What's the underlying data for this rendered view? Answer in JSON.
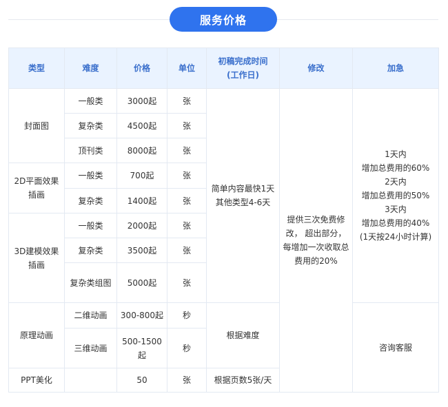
{
  "title": "服务价格",
  "headers": {
    "type": "类型",
    "difficulty": "难度",
    "price": "价格",
    "unit": "单位",
    "first_draft_line1": "初稿完成时间",
    "first_draft_line2": "(工作日)",
    "revision": "修改",
    "rush": "加急"
  },
  "categories": {
    "cover": "封面图",
    "flat2d": "2D平面效果插画",
    "model3d": "3D建模效果插画",
    "animation": "原理动画",
    "ppt": "PPT美化"
  },
  "rows": [
    {
      "difficulty": "一般类",
      "price": "3000起",
      "unit": "张"
    },
    {
      "difficulty": "复杂类",
      "price": "4500起",
      "unit": "张"
    },
    {
      "difficulty": "顶刊类",
      "price": "8000起",
      "unit": "张"
    },
    {
      "difficulty": "一般类",
      "price": "700起",
      "unit": "张"
    },
    {
      "difficulty": "复杂类",
      "price": "1400起",
      "unit": "张"
    },
    {
      "difficulty": "一般类",
      "price": "2000起",
      "unit": "张"
    },
    {
      "difficulty": "复杂类",
      "price": "3500起",
      "unit": "张"
    },
    {
      "difficulty": "复杂类组图",
      "price": "5000起",
      "unit": "张"
    },
    {
      "difficulty": "二维动画",
      "price": "300-800起",
      "unit": "秒"
    },
    {
      "difficulty": "三维动画",
      "price": "500-1500起",
      "unit": "秒"
    },
    {
      "difficulty": "",
      "price": "50",
      "unit": "张"
    }
  ],
  "first_draft": {
    "illustration": "简单内容最快1天 其他类型4-6天",
    "animation": "根据难度",
    "ppt": "根据页数5张/天"
  },
  "revision_note": "提供三次免费修改， 超出部分，每增加一次收取总费用的20%",
  "rush": {
    "line1": "1天内",
    "line2": "增加总费用的60%",
    "line3": "2天内",
    "line4": "增加总费用的50%",
    "line5": "3天内",
    "line6": "增加总费用的40%",
    "line7": "(1天按24小时计算)",
    "consult": "咨询客服"
  },
  "colors": {
    "accent": "#2f73ee",
    "header_bg": "#eaf3ff",
    "header_text": "#3a6fcc",
    "border": "#e3e9f2"
  }
}
